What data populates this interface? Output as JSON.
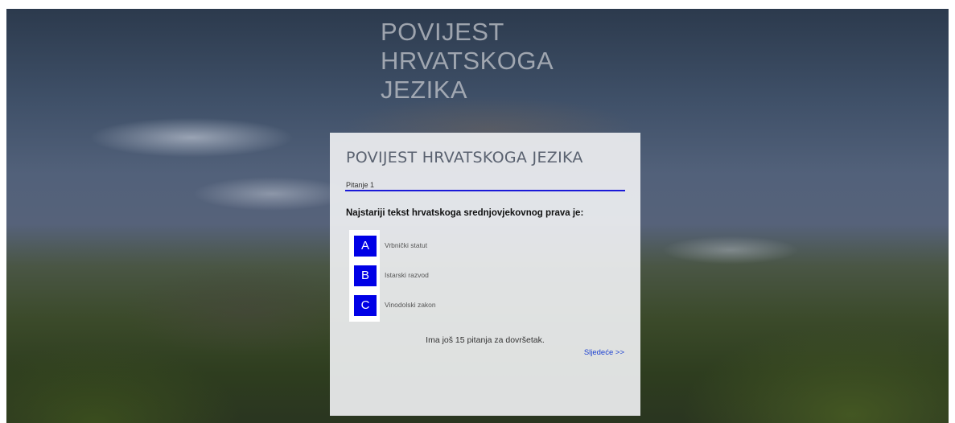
{
  "background_title": [
    "POVIJEST",
    "HRVATSKOGA",
    "JEZIKA"
  ],
  "quiz": {
    "title": "POVIJEST HRVATSKOGA JEZIKA",
    "question_number_label": "Pitanje 1",
    "question_text": "Najstariji tekst hrvatskoga srednjovjekovnog prava je:",
    "options": [
      {
        "letter": "A",
        "text": "Vrbnički statut"
      },
      {
        "letter": "B",
        "text": "Istarski razvod"
      },
      {
        "letter": "C",
        "text": "Vinodolski zakon"
      }
    ],
    "remaining_text": "Ima još 15 pitanja za dovršetak.",
    "next_label": "Sljedeće >>"
  },
  "colors": {
    "accent": "#0000e6",
    "underline": "#1a1ad8",
    "link": "#1a3fd0",
    "card_bg": "#eeeff1"
  }
}
